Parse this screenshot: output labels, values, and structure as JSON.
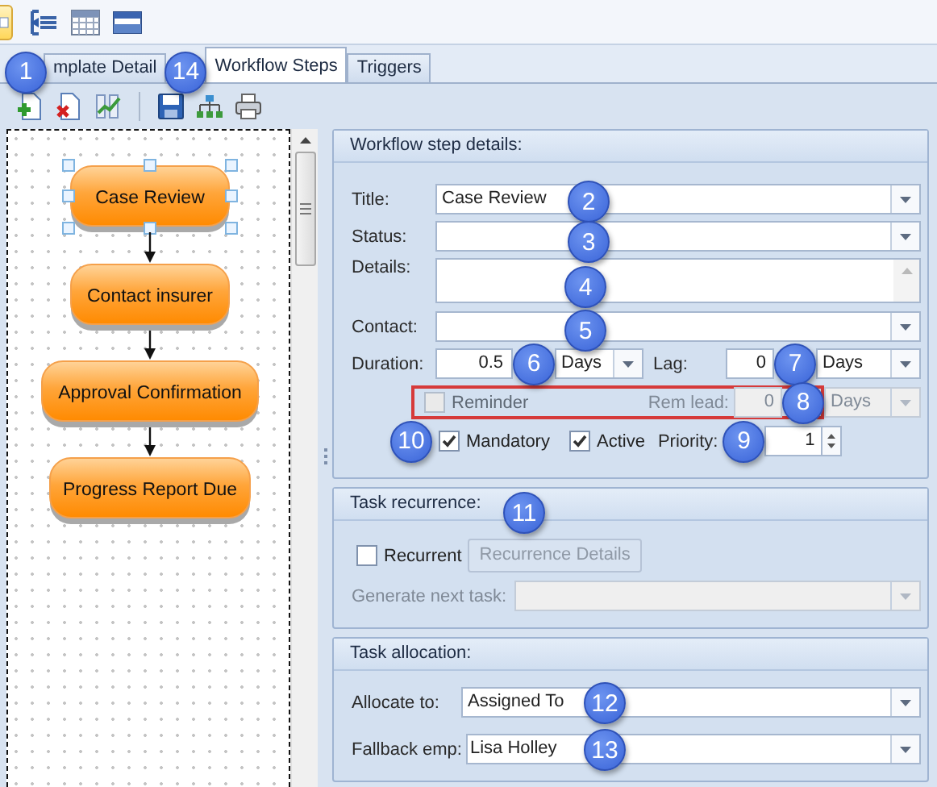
{
  "view_buttons": [
    {
      "selected": true
    },
    {
      "selected": false
    },
    {
      "selected": false
    },
    {
      "selected": false
    }
  ],
  "tabs": [
    {
      "label": "mplate Detail",
      "selected": false
    },
    {
      "label": "Workflow Steps",
      "selected": true
    },
    {
      "label": "Triggers",
      "selected": false
    }
  ],
  "diagram": {
    "nodes": [
      {
        "label": "Case Review",
        "selected": true
      },
      {
        "label": "Contact insurer",
        "selected": false
      },
      {
        "label": "Approval Confirmation",
        "selected": false
      },
      {
        "label": "Progress Report Due",
        "selected": false
      }
    ]
  },
  "step_details": {
    "heading": "Workflow step details:",
    "title": {
      "label": "Title:",
      "value": "Case Review"
    },
    "status": {
      "label": "Status:"
    },
    "details": {
      "label": "Details:"
    },
    "contact": {
      "label": "Contact:"
    },
    "duration": {
      "label": "Duration:",
      "value": "0.5",
      "unit": "Days"
    },
    "lag": {
      "label": "Lag:",
      "value": "0",
      "unit": "Days"
    },
    "reminder": {
      "label": "Reminder",
      "checked": false,
      "disabled": true,
      "highlighted": true,
      "lead_label": "Rem lead:",
      "lead_value": "0",
      "unit": "Days"
    },
    "mandatory": {
      "label": "Mandatory",
      "checked": true
    },
    "active": {
      "label": "Active",
      "checked": true
    },
    "priority": {
      "label": "Priority:",
      "value": "1"
    }
  },
  "recurrence": {
    "heading": "Task recurrence:",
    "recurrent": {
      "label": "Recurrent",
      "checked": false
    },
    "details_button": {
      "label": "Recurrence Details",
      "disabled": true
    },
    "next_task": {
      "label": "Generate next task:",
      "disabled": true
    }
  },
  "allocation": {
    "heading": "Task allocation:",
    "allocate_to": {
      "label": "Allocate to:",
      "value": "Assigned To"
    },
    "fallback": {
      "label": "Fallback emp:",
      "value": "Lisa Holley"
    }
  },
  "callouts": [
    {
      "number": "1"
    },
    {
      "number": "14"
    },
    {
      "number": "2"
    },
    {
      "number": "3"
    },
    {
      "number": "4"
    },
    {
      "number": "5"
    },
    {
      "number": "6"
    },
    {
      "number": "7"
    },
    {
      "number": "8"
    },
    {
      "number": "10"
    },
    {
      "number": "9"
    },
    {
      "number": "11"
    },
    {
      "number": "12"
    },
    {
      "number": "13"
    }
  ]
}
